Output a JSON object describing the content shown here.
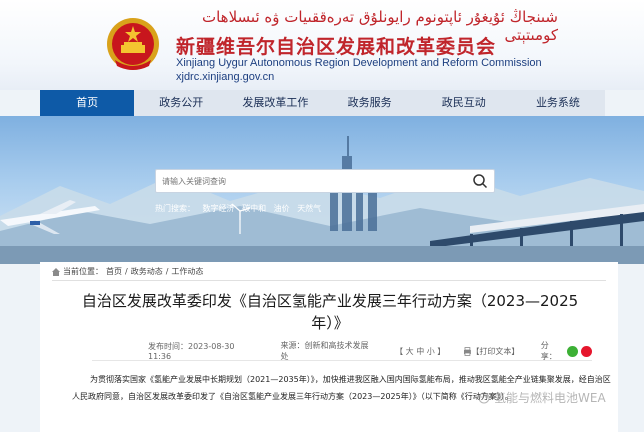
{
  "header": {
    "uyghur_name": "شىنجاڭ ئۇيغۇر ئاپتونوم رايونلۇق تەرەققىيات ۋە ئىسلاھات كومىتېتى",
    "cn_name": "新疆维吾尔自治区发展和改革委员会",
    "en_name": "Xinjiang Uygur Autonomous Region Development and Reform Commission",
    "url": "xjdrc.xinjiang.gov.cn"
  },
  "nav": {
    "items": [
      {
        "label": "首页",
        "active": true
      },
      {
        "label": "政务公开"
      },
      {
        "label": "发展改革工作"
      },
      {
        "label": "政务服务"
      },
      {
        "label": "政民互动"
      },
      {
        "label": "业务系统"
      }
    ]
  },
  "search": {
    "placeholder": "请输入关键词查询",
    "hot_label": "热门搜索：",
    "hot_terms": [
      "数字经济",
      "碳中和",
      "油价",
      "天然气"
    ]
  },
  "breadcrumb": {
    "label": "当前位置：",
    "items": [
      "首页",
      "政务动态",
      "工作动态"
    ],
    "separator": "/"
  },
  "article": {
    "title": "自治区发展改革委印发《自治区氢能产业发展三年行动方案（2023—2025年）》",
    "publish_time": "发布时间：2023-08-30 11:36",
    "source": "来源：创新和高技术发展处",
    "font_size": "【 大  中  小 】",
    "print": "【打印文本】",
    "share_label": "分享：",
    "body": "为贯彻落实国家《氢能产业发展中长期规划（2021—2035年）》，加快推进我区融入国内国际氢能布局，推动我区氢能全产业链集聚发展，经自治区人民政府同意，自治区发展改革委印发了《自治区氢能产业发展三年行动方案（2023—2025年）》（以下简称《行动方案》）。"
  },
  "watermark": "氢能与燃料电池WEA",
  "colors": {
    "brand_red": "#c0252b",
    "nav_active": "#0e5aa7",
    "wechat": "#3cb035",
    "weibo": "#e6162d"
  }
}
